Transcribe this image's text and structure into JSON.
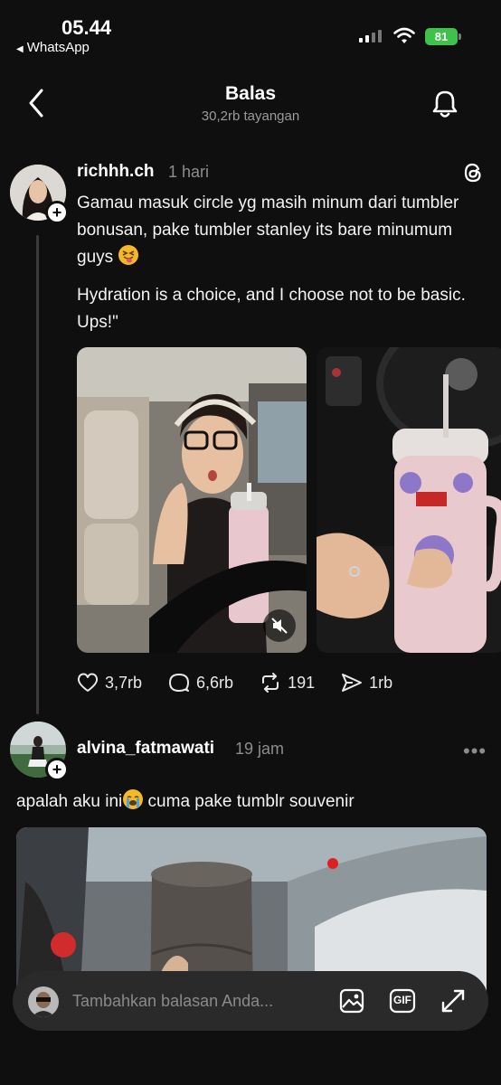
{
  "status_bar": {
    "time": "05.44",
    "back_app": "WhatsApp",
    "battery": "81"
  },
  "header": {
    "title": "Balas",
    "views": "30,2rb tayangan"
  },
  "posts": [
    {
      "username": "richhh.ch",
      "time_ago": "1 hari",
      "text_1": "Gamau masuk circle yg masih minum dari tumbler bonusan, pake tumbler stanley its bare minumum guys",
      "text_2": "Hydration is a choice, and I choose not to be basic. Ups!\"",
      "stats": {
        "likes": "3,7rb",
        "comments": "6,6rb",
        "reposts": "191",
        "shares": "1rb"
      }
    },
    {
      "username": "alvina_fatmawati",
      "time_ago": "19 jam",
      "text": "apalah aku ini",
      "text_after_emoji": " cuma pake tumblr souvenir"
    }
  ],
  "reply_bar": {
    "placeholder": "Tambahkan balasan Anda...",
    "gif_label": "GIF"
  },
  "colors": {
    "background": "#0f0f0f",
    "battery": "#3ec24a",
    "reply_bar": "#2a2a2a",
    "muted_text": "#8d8d8d"
  },
  "icons": [
    "back-arrow-icon",
    "bell-icon",
    "threads-logo-icon",
    "heart-icon",
    "comment-icon",
    "repost-icon",
    "share-icon",
    "mute-icon",
    "image-icon",
    "gif-icon",
    "expand-icon",
    "more-icon"
  ]
}
